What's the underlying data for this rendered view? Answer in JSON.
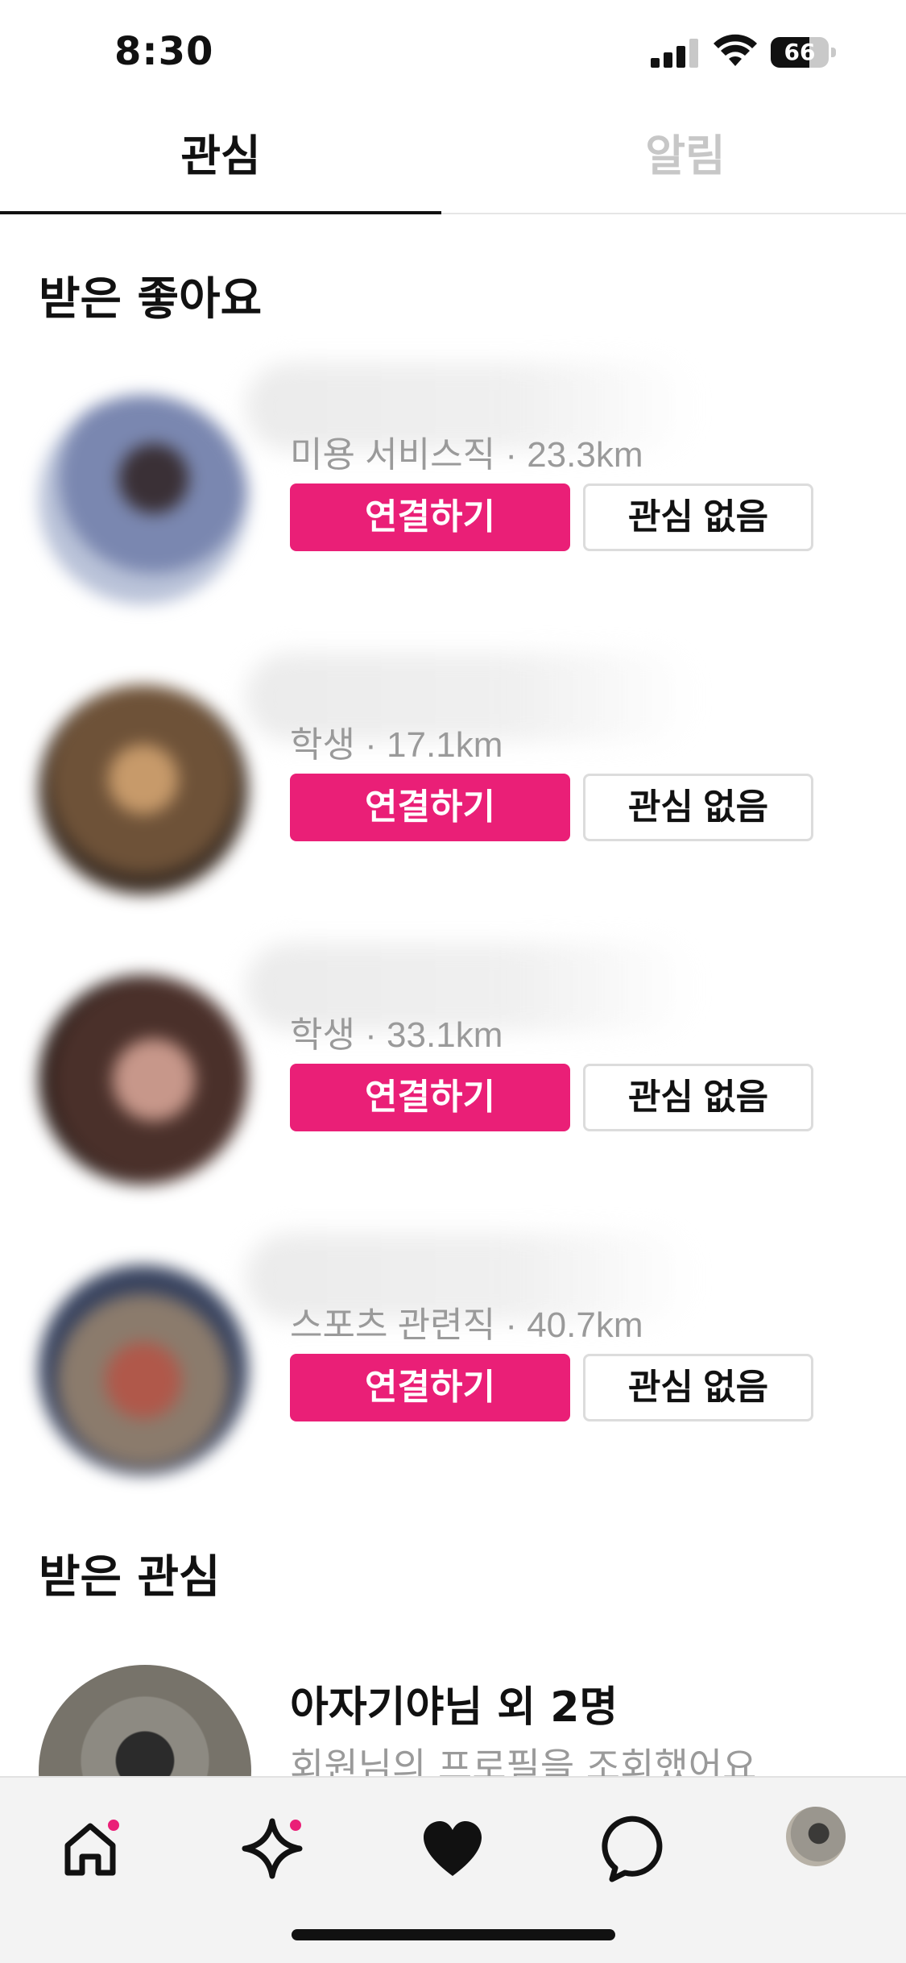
{
  "status_bar": {
    "time": "8:30",
    "battery": "66",
    "battery_level": 0.66
  },
  "tabs": [
    {
      "label": "관심",
      "active": true
    },
    {
      "label": "알림",
      "active": false
    }
  ],
  "likes_section": {
    "title": "받은 좋아요",
    "items": [
      {
        "meta": "미용 서비스직 · 23.3km",
        "connect_label": "연결하기",
        "pass_label": "관심 없음",
        "avatar_color": "#6f7fa8"
      },
      {
        "meta": "학생 · 17.1km",
        "connect_label": "연결하기",
        "pass_label": "관심 없음",
        "avatar_color": "#8a6d52"
      },
      {
        "meta": "학생 · 33.1km",
        "connect_label": "연결하기",
        "pass_label": "관심 없음",
        "avatar_color": "#6a4a3c"
      },
      {
        "meta": "스포츠 관련직 · 40.7km",
        "connect_label": "연결하기",
        "pass_label": "관심 없음",
        "avatar_color": "#7a6a60"
      }
    ]
  },
  "interest_section": {
    "title": "받은 관심",
    "item": {
      "title": "아자기야님 외 2명",
      "subtitle": "회원님의 프로필을 조회했어요"
    }
  },
  "bottom_nav": [
    {
      "icon": "home-icon",
      "badge": true
    },
    {
      "icon": "sparkle-icon",
      "badge": true
    },
    {
      "icon": "heart-icon",
      "badge": false,
      "active": true
    },
    {
      "icon": "chat-icon",
      "badge": false
    },
    {
      "icon": "profile-avatar",
      "badge": false
    }
  ],
  "colors": {
    "accent": "#ea1f77",
    "muted_text": "#9a9a9a",
    "nav_bg": "#f3f3f3"
  }
}
